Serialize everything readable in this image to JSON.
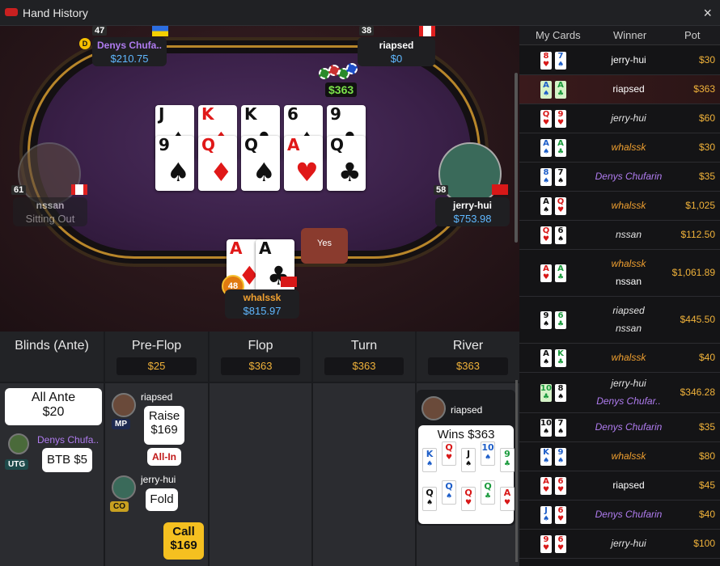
{
  "window": {
    "title": "Hand History",
    "close_icon": "×"
  },
  "table": {
    "pot": "$363",
    "bubble": "Yes",
    "board": [
      {
        "rank": "J",
        "suit": "♠",
        "color": "black"
      },
      {
        "rank": "K",
        "suit": "♦",
        "color": "red"
      },
      {
        "rank": "K",
        "suit": "♣",
        "color": "black"
      },
      {
        "rank": "6",
        "suit": "♠",
        "color": "black"
      },
      {
        "rank": "9",
        "suit": "♣",
        "color": "black"
      },
      {
        "rank": "9",
        "suit": "♠",
        "color": "black"
      },
      {
        "rank": "Q",
        "suit": "♦",
        "color": "red"
      },
      {
        "rank": "Q",
        "suit": "♠",
        "color": "black"
      },
      {
        "rank": "A",
        "suit": "♥",
        "color": "red"
      },
      {
        "rank": "Q",
        "suit": "♣",
        "color": "black"
      }
    ],
    "players": {
      "top_left": {
        "name": "Denys Chufa..",
        "stack": "$210.75",
        "level": "47"
      },
      "top_right": {
        "name": "riapsed",
        "stack": "$0",
        "level": "38"
      },
      "left": {
        "name": "nssan",
        "status": "Sitting Out",
        "level": "61"
      },
      "right": {
        "name": "jerry-hui",
        "stack": "$753.98",
        "level": "58"
      },
      "hero": {
        "name": "whalssk",
        "stack": "$815.97",
        "level": "48",
        "cards": [
          {
            "rank": "A",
            "suit": "♦",
            "color": "red"
          },
          {
            "rank": "A",
            "suit": "♣",
            "color": "black"
          }
        ]
      }
    }
  },
  "streets": {
    "headers": [
      {
        "label": "Blinds (Ante)",
        "pot": ""
      },
      {
        "label": "Pre-Flop",
        "pot": "$25"
      },
      {
        "label": "Flop",
        "pot": "$363"
      },
      {
        "label": "Turn",
        "pot": "$363"
      },
      {
        "label": "River",
        "pot": "$363"
      }
    ],
    "blinds": {
      "ante_label": "All Ante",
      "ante_amount": "$20",
      "player": "Denys Chufa..",
      "position": "UTG",
      "action": "BTB",
      "amount": "$5"
    },
    "preflop": [
      {
        "player": "riapsed",
        "position": "MP",
        "action": "Raise",
        "amount": "$169",
        "tag": "All-In"
      },
      {
        "player": "jerry-hui",
        "position": "CO",
        "action": "Fold"
      },
      {
        "action": "Call",
        "amount": "$169"
      }
    ],
    "river": {
      "player": "riapsed",
      "result": "Wins $363",
      "row1": [
        {
          "r": "K",
          "s": "♠",
          "c": "blue"
        },
        {
          "r": "Q",
          "s": "♥",
          "c": "red"
        },
        {
          "r": "J",
          "s": "♠",
          "c": "black"
        },
        {
          "r": "10",
          "s": "♠",
          "c": "blue"
        },
        {
          "r": "9",
          "s": "♣",
          "c": "green"
        }
      ],
      "row2": [
        {
          "r": "Q",
          "s": "♠",
          "c": "black"
        },
        {
          "r": "Q",
          "s": "♠",
          "c": "blue"
        },
        {
          "r": "Q",
          "s": "♥",
          "c": "red"
        },
        {
          "r": "Q",
          "s": "♣",
          "c": "green"
        },
        {
          "r": "A",
          "s": "♥",
          "c": "red"
        }
      ]
    }
  },
  "history": {
    "headers": {
      "cards": "My Cards",
      "winner": "Winner",
      "pot": "Pot"
    },
    "rows": [
      {
        "c1": {
          "r": "8",
          "s": "♥",
          "col": "red"
        },
        "c2": {
          "r": "7",
          "s": "♠",
          "col": "blue"
        },
        "winners": [
          "jerry-hui"
        ],
        "style": "normal",
        "pot": "$30"
      },
      {
        "c1": {
          "r": "A",
          "s": "♠",
          "col": "blue"
        },
        "c2": {
          "r": "A",
          "s": "♣",
          "col": "green"
        },
        "winners": [
          "riapsed"
        ],
        "style": "normal",
        "pot": "$363",
        "selected": true
      },
      {
        "c1": {
          "r": "Q",
          "s": "♥",
          "col": "red"
        },
        "c2": {
          "r": "9",
          "s": "♥",
          "col": "red"
        },
        "winners": [
          "jerry-hui"
        ],
        "style": "alt",
        "pot": "$60"
      },
      {
        "c1": {
          "r": "A",
          "s": "♠",
          "col": "blue"
        },
        "c2": {
          "r": "A",
          "s": "♣",
          "col": "green"
        },
        "winners": [
          "whalssk"
        ],
        "style": "orange",
        "pot": "$30"
      },
      {
        "c1": {
          "r": "8",
          "s": "♠",
          "col": "blue"
        },
        "c2": {
          "r": "7",
          "s": "♠",
          "col": "black"
        },
        "winners": [
          "Denys Chufarin"
        ],
        "style": "purple",
        "pot": "$35"
      },
      {
        "c1": {
          "r": "A",
          "s": "♠",
          "col": "black"
        },
        "c2": {
          "r": "Q",
          "s": "♥",
          "col": "red"
        },
        "winners": [
          "whalssk"
        ],
        "style": "orange",
        "pot": "$1,025"
      },
      {
        "c1": {
          "r": "Q",
          "s": "♥",
          "col": "red"
        },
        "c2": {
          "r": "6",
          "s": "♠",
          "col": "black"
        },
        "winners": [
          "nssan"
        ],
        "style": "alt",
        "pot": "$112.50"
      },
      {
        "c1": {
          "r": "A",
          "s": "♥",
          "col": "red"
        },
        "c2": {
          "r": "A",
          "s": "♣",
          "col": "green"
        },
        "winners": [
          "whalssk",
          "nssan"
        ],
        "style": "orange",
        "pot": "$1,061.89"
      },
      {
        "c1": {
          "r": "9",
          "s": "♠",
          "col": "black"
        },
        "c2": {
          "r": "6",
          "s": "♣",
          "col": "green"
        },
        "winners": [
          "riapsed",
          "nssan"
        ],
        "style": "alt",
        "pot": "$445.50"
      },
      {
        "c1": {
          "r": "A",
          "s": "♠",
          "col": "black"
        },
        "c2": {
          "r": "K",
          "s": "♣",
          "col": "green"
        },
        "winners": [
          "whalssk"
        ],
        "style": "orange",
        "pot": "$40"
      },
      {
        "c1": {
          "r": "10",
          "s": "♣",
          "col": "green"
        },
        "c2": {
          "r": "8",
          "s": "♠",
          "col": "black"
        },
        "winners": [
          "jerry-hui",
          "Denys Chufar.."
        ],
        "style": "mixed",
        "pot": "$346.28"
      },
      {
        "c1": {
          "r": "10",
          "s": "♠",
          "col": "black"
        },
        "c2": {
          "r": "7",
          "s": "♠",
          "col": "black"
        },
        "winners": [
          "Denys Chufarin"
        ],
        "style": "purple",
        "pot": "$35"
      },
      {
        "c1": {
          "r": "K",
          "s": "♠",
          "col": "blue"
        },
        "c2": {
          "r": "9",
          "s": "♠",
          "col": "blue"
        },
        "winners": [
          "whalssk"
        ],
        "style": "orange",
        "pot": "$80"
      },
      {
        "c1": {
          "r": "A",
          "s": "♥",
          "col": "red"
        },
        "c2": {
          "r": "6",
          "s": "♥",
          "col": "red"
        },
        "winners": [
          "riapsed"
        ],
        "style": "normal",
        "pot": "$45"
      },
      {
        "c1": {
          "r": "J",
          "s": "♠",
          "col": "blue"
        },
        "c2": {
          "r": "6",
          "s": "♥",
          "col": "red"
        },
        "winners": [
          "Denys Chufarin"
        ],
        "style": "purple",
        "pot": "$40"
      },
      {
        "c1": {
          "r": "9",
          "s": "♥",
          "col": "red"
        },
        "c2": {
          "r": "6",
          "s": "♥",
          "col": "red"
        },
        "winners": [
          "jerry-hui"
        ],
        "style": "alt",
        "pot": "$100"
      }
    ]
  }
}
